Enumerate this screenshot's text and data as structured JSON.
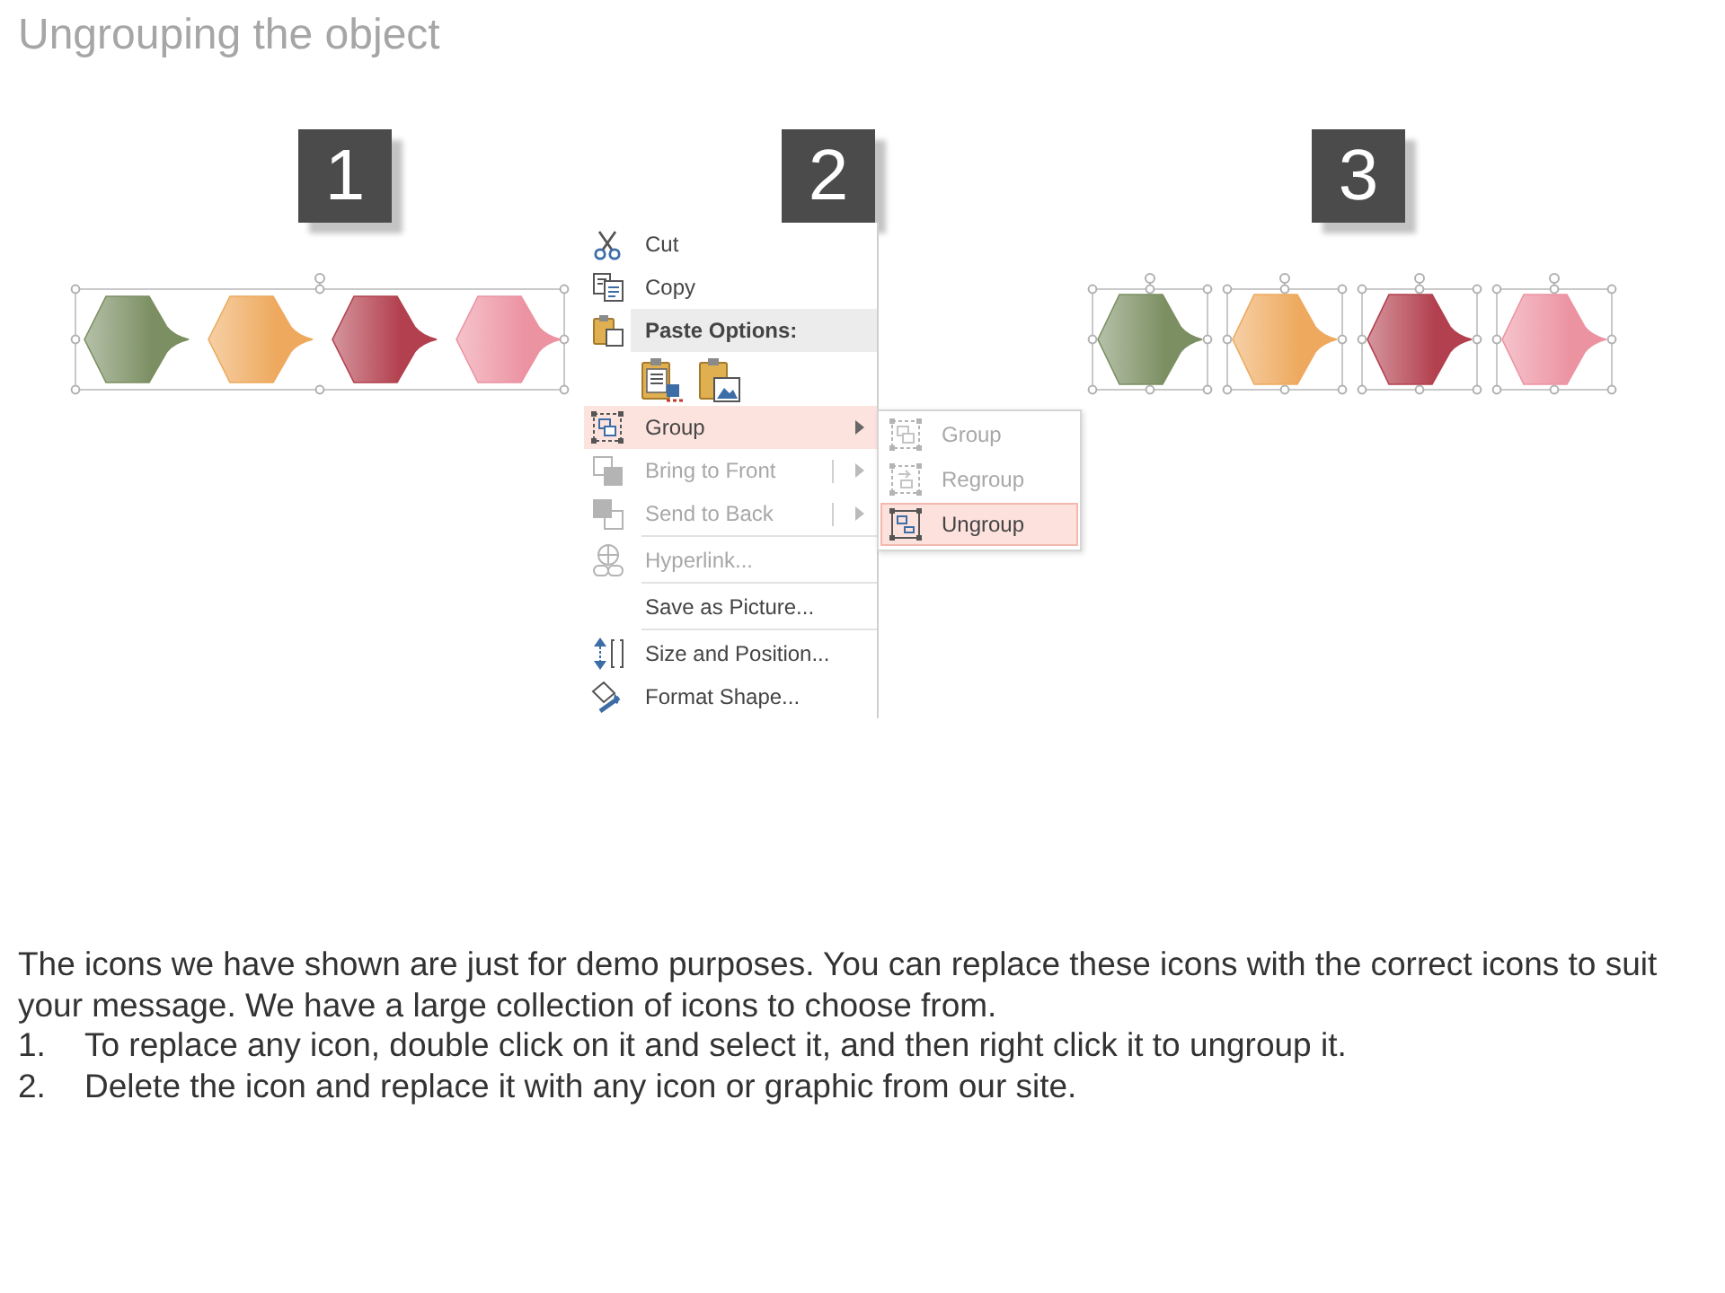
{
  "title": "Ungrouping the object",
  "steps": [
    {
      "kind": "grouped",
      "number": "1",
      "shapes": [
        {
          "color": "#7b8f62"
        },
        {
          "color": "#eea95e"
        },
        {
          "color": "#b3404e"
        },
        {
          "color": "#ec93a2"
        }
      ]
    },
    {
      "kind": "menu",
      "number": "2",
      "context_menu": {
        "items": [
          {
            "kind": "command",
            "label": "Cut",
            "disabled": false,
            "selected": false
          },
          {
            "kind": "command",
            "label": "Copy",
            "disabled": false,
            "selected": false
          },
          {
            "kind": "header",
            "label": "Paste Options:"
          },
          {
            "kind": "paste-row"
          },
          {
            "kind": "submenu",
            "label": "Group",
            "disabled": false,
            "selected": true
          },
          {
            "kind": "split",
            "label": "Bring to Front",
            "disabled": true,
            "selected": false
          },
          {
            "kind": "split",
            "label": "Send to Back",
            "disabled": true,
            "selected": false
          },
          {
            "kind": "separator"
          },
          {
            "kind": "command",
            "label": "Hyperlink...",
            "disabled": true,
            "selected": false
          },
          {
            "kind": "separator"
          },
          {
            "kind": "command",
            "label": "Save as Picture...",
            "disabled": false,
            "selected": false
          },
          {
            "kind": "separator"
          },
          {
            "kind": "command",
            "label": "Size and Position...",
            "disabled": false,
            "selected": false
          },
          {
            "kind": "command",
            "label": "Format Shape...",
            "disabled": false,
            "selected": false
          }
        ]
      },
      "submenu": {
        "items": [
          {
            "label": "Group",
            "disabled": true,
            "selected": false
          },
          {
            "label": "Regroup",
            "disabled": true,
            "selected": false
          },
          {
            "label": "Ungroup",
            "disabled": false,
            "selected": true
          }
        ]
      }
    },
    {
      "kind": "ungrouped",
      "number": "3",
      "shapes": [
        {
          "color": "#7b8f62"
        },
        {
          "color": "#eea95e"
        },
        {
          "color": "#b3404e"
        },
        {
          "color": "#ec93a2"
        }
      ]
    }
  ],
  "description": {
    "paragraph": "The icons we have shown are just for demo purposes. You can replace these icons with the correct icons to suit your message. We have a large collection of icons to choose from.",
    "steps": [
      {
        "number": "1.",
        "text": "To replace any icon, double click on it and select it, and then right click it to ungroup it."
      },
      {
        "number": "2.",
        "text": "Delete the icon and replace it with any icon or graphic from our site."
      }
    ]
  }
}
